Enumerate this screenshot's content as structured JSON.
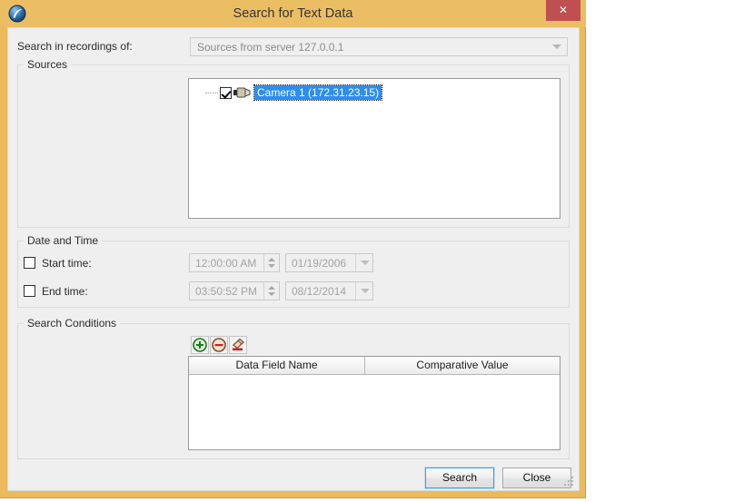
{
  "window": {
    "title": "Search for Text Data",
    "icon_name": "app-sphere-icon",
    "close_label": "✕",
    "frame_color": "#eaba5c",
    "titlebar_color": "#ecbe63",
    "close_color": "#c04f51"
  },
  "search_in": {
    "label": "Search in recordings of:",
    "selected": "Sources from server 127.0.0.1",
    "placeholder": "Sources from server 127.0.0.1"
  },
  "sources": {
    "group_label": "Sources",
    "items": [
      {
        "label": "Camera 1 (172.31.23.15)",
        "checked": true,
        "selected": true,
        "icon_name": "camera-icon"
      }
    ],
    "selection_color": "#2d8ef0"
  },
  "date_time": {
    "group_label": "Date and Time",
    "rows": [
      {
        "checkbox_label": "Start time:",
        "checked": false,
        "time_value": "12:00:00 AM",
        "date_value": "01/19/2006"
      },
      {
        "checkbox_label": "End time:",
        "checked": false,
        "time_value": "03:50:52 PM",
        "date_value": "08/12/2014"
      }
    ]
  },
  "search_conditions": {
    "group_label": "Search Conditions",
    "toolbar": [
      {
        "name": "add-condition-button",
        "icon": "plus-circle-icon",
        "tooltip": "Add"
      },
      {
        "name": "remove-condition-button",
        "icon": "minus-circle-icon",
        "tooltip": "Remove"
      },
      {
        "name": "clear-conditions-button",
        "icon": "eraser-icon",
        "tooltip": "Clear"
      }
    ],
    "columns": [
      "Data Field Name",
      "Comparative Value"
    ],
    "rows": []
  },
  "footer": {
    "search_label": "Search",
    "close_label": "Close"
  }
}
